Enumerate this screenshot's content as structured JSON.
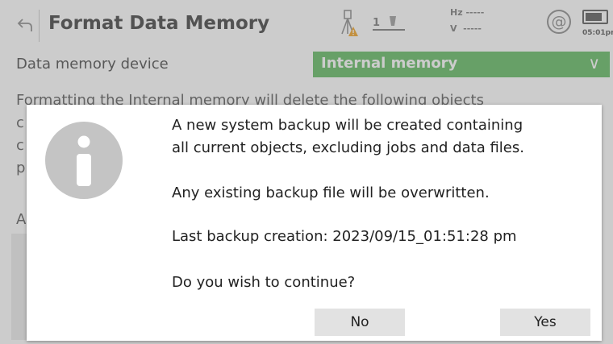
{
  "header": {
    "title": "Format Data Memory",
    "prism_label": "1",
    "hz_label": "Hz -----",
    "v_label": "V  -----",
    "at_symbol": "@",
    "time": "05:01pm",
    "icons": [
      "back-icon",
      "tripod-warning-icon",
      "prism-icon",
      "at-icon",
      "battery-icon"
    ]
  },
  "memory_device": {
    "label": "Data memory device",
    "value": "Internal memory",
    "accent_color": "#5cb85c"
  },
  "background": {
    "info_text": "Formatting the Internal memory will delete the following objects",
    "fragments": [
      "c",
      "c",
      "p",
      "A"
    ]
  },
  "dialog": {
    "icon": "info-icon",
    "line1": "A new system backup will be created containing",
    "line2": "all current objects, excluding jobs and data files.",
    "line3": "Any existing backup file will be overwritten.",
    "line4": "Last backup creation: 2023/09/15_01:51:28 pm",
    "line5": "Do you wish to continue?",
    "no_label": "No",
    "yes_label": "Yes"
  }
}
